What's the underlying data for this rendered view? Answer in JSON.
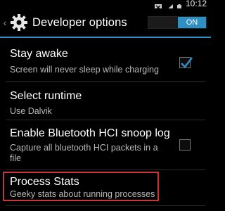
{
  "status_bar": {
    "time": "10:12"
  },
  "action_bar": {
    "title": "Developer options",
    "switch_label": "ON"
  },
  "items": [
    {
      "title": "Stay awake",
      "summary": "Screen will never sleep while charging",
      "checked": true
    },
    {
      "title": "Select runtime",
      "summary": "Use Dalvik"
    },
    {
      "title": "Enable Bluetooth HCI snoop log",
      "summary_line1": "Capture all bluetooth HCI packets in a",
      "summary_line2": "file",
      "checked": false
    },
    {
      "title": "Process Stats",
      "summary": "Geeky stats about running processes"
    }
  ],
  "colors": {
    "accent": "#2f8fc3",
    "highlight": "#c9333a"
  }
}
